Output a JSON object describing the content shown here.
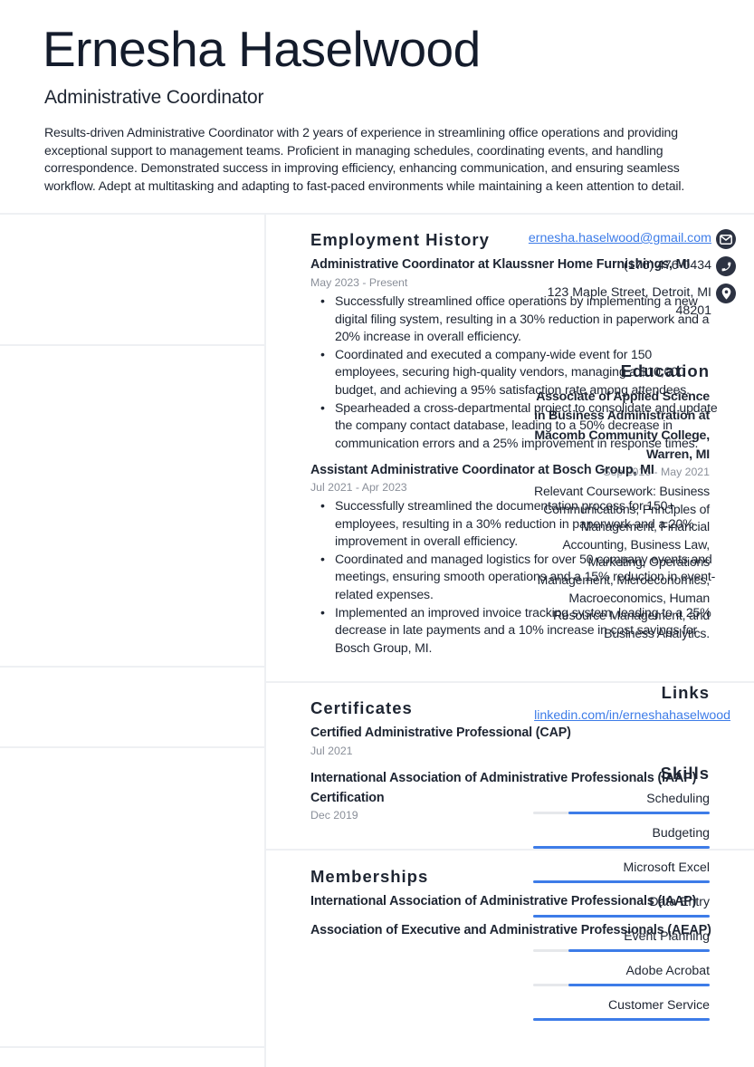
{
  "header": {
    "name": "Ernesha Haselwood",
    "title": "Administrative Coordinator",
    "summary": "Results-driven Administrative Coordinator with 2 years of experience in streamlining office operations and providing exceptional support to management teams. Proficient in managing schedules, coordinating events, and handling correspondence. Demonstrated success in improving efficiency, enhancing communication, and ensuring seamless workflow. Adept at multitasking and adapting to fast-paced environments while maintaining a keen attention to detail."
  },
  "contact": {
    "email": "ernesha.haselwood@gmail.com",
    "phone": "(176) 476-0434",
    "address_line1": "123 Maple Street, Detroit, MI",
    "address_line2": "48201",
    "icons": [
      "envelope-icon",
      "phone-icon",
      "map-pin-icon"
    ]
  },
  "education": {
    "heading": "Education",
    "degree": "Associate of Applied Science in Business Administration at Macomb Community College, Warren, MI",
    "dates": "Sep 2016 - May 2021",
    "description": "Relevant Coursework: Business Communications, Principles of Management, Financial Accounting, Business Law, Marketing, Operations Management, Microeconomics, Macroeconomics, Human Resource Management, and Business Analytics."
  },
  "links": {
    "heading": "Links",
    "items": [
      "linkedin.com/in/erneshahaselwood"
    ]
  },
  "skills": {
    "heading": "Skills",
    "accent_color": "#3d7ce8",
    "items": [
      {
        "name": "Scheduling",
        "level": 0.8
      },
      {
        "name": "Budgeting",
        "level": 1.0
      },
      {
        "name": "Microsoft Excel",
        "level": 1.0
      },
      {
        "name": "Data Entry",
        "level": 1.0
      },
      {
        "name": "Event Planning",
        "level": 0.8
      },
      {
        "name": "Adobe Acrobat",
        "level": 0.8
      },
      {
        "name": "Customer Service",
        "level": 1.0
      }
    ]
  },
  "employment": {
    "heading": "Employment History",
    "jobs": [
      {
        "title": "Administrative Coordinator at Klaussner Home Furnishings, MI",
        "dates": "May 2023 - Present",
        "bullets": [
          "Successfully streamlined office operations by implementing a new digital filing system, resulting in a 30% reduction in paperwork and a 20% increase in overall efficiency.",
          "Coordinated and executed a company-wide event for 150 employees, securing high-quality vendors, managing a $10,000 budget, and achieving a 95% satisfaction rate among attendees.",
          "Spearheaded a cross-departmental project to consolidate and update the company contact database, leading to a 50% decrease in communication errors and a 25% improvement in response times."
        ]
      },
      {
        "title": "Assistant Administrative Coordinator at Bosch Group, MI",
        "dates": "Jul 2021 - Apr 2023",
        "bullets": [
          "Successfully streamlined the documentation process for 150+ employees, resulting in a 30% reduction in paperwork and a 20% improvement in overall efficiency.",
          "Coordinated and managed logistics for over 50 company events and meetings, ensuring smooth operations and a 15% reduction in event-related expenses.",
          "Implemented an improved invoice tracking system, leading to a 25% decrease in late payments and a 10% increase in cost savings for Bosch Group, MI."
        ]
      }
    ]
  },
  "certificates": {
    "heading": "Certificates",
    "items": [
      {
        "name": "Certified Administrative Professional (CAP)",
        "date": "Jul 2021"
      },
      {
        "name": "International Association of Administrative Professionals (IAAP) Certification",
        "date": "Dec 2019"
      }
    ]
  },
  "memberships": {
    "heading": "Memberships",
    "items": [
      "International Association of Administrative Professionals (IAAP)",
      "Association of Executive and Administrative Professionals (AEAP)"
    ]
  }
}
